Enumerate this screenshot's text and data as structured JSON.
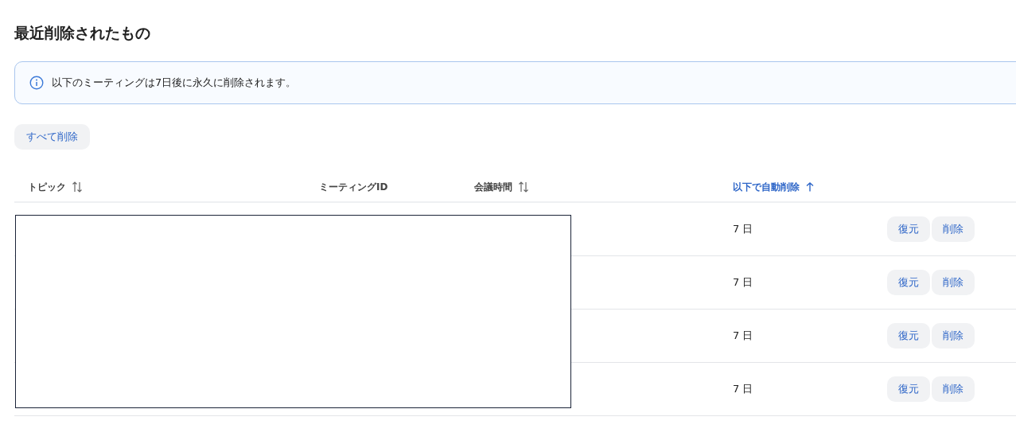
{
  "title": "最近削除されたもの",
  "banner": {
    "text": "以下のミーティングは7日後に永久に削除されます。"
  },
  "delete_all_button": "すべて削除",
  "table": {
    "columns": [
      {
        "label": "トピック",
        "kind": "sortable",
        "selected": false
      },
      {
        "label": "ミーティングID",
        "kind": "plain",
        "selected": false
      },
      {
        "label": "会議時間",
        "kind": "sortable",
        "selected": false
      },
      {
        "label": "以下で自動削除",
        "kind": "ascending",
        "selected": true
      }
    ],
    "rows": [
      {
        "auto_delete": "7 日",
        "actions": [
          "復元",
          "削除"
        ]
      },
      {
        "auto_delete": "7 日",
        "actions": [
          "復元",
          "削除"
        ]
      },
      {
        "auto_delete": "7 日",
        "actions": [
          "復元",
          "削除"
        ]
      },
      {
        "auto_delete": "7 日",
        "actions": [
          "復元",
          "削除"
        ]
      }
    ]
  },
  "redaction": {
    "kind": "box"
  }
}
